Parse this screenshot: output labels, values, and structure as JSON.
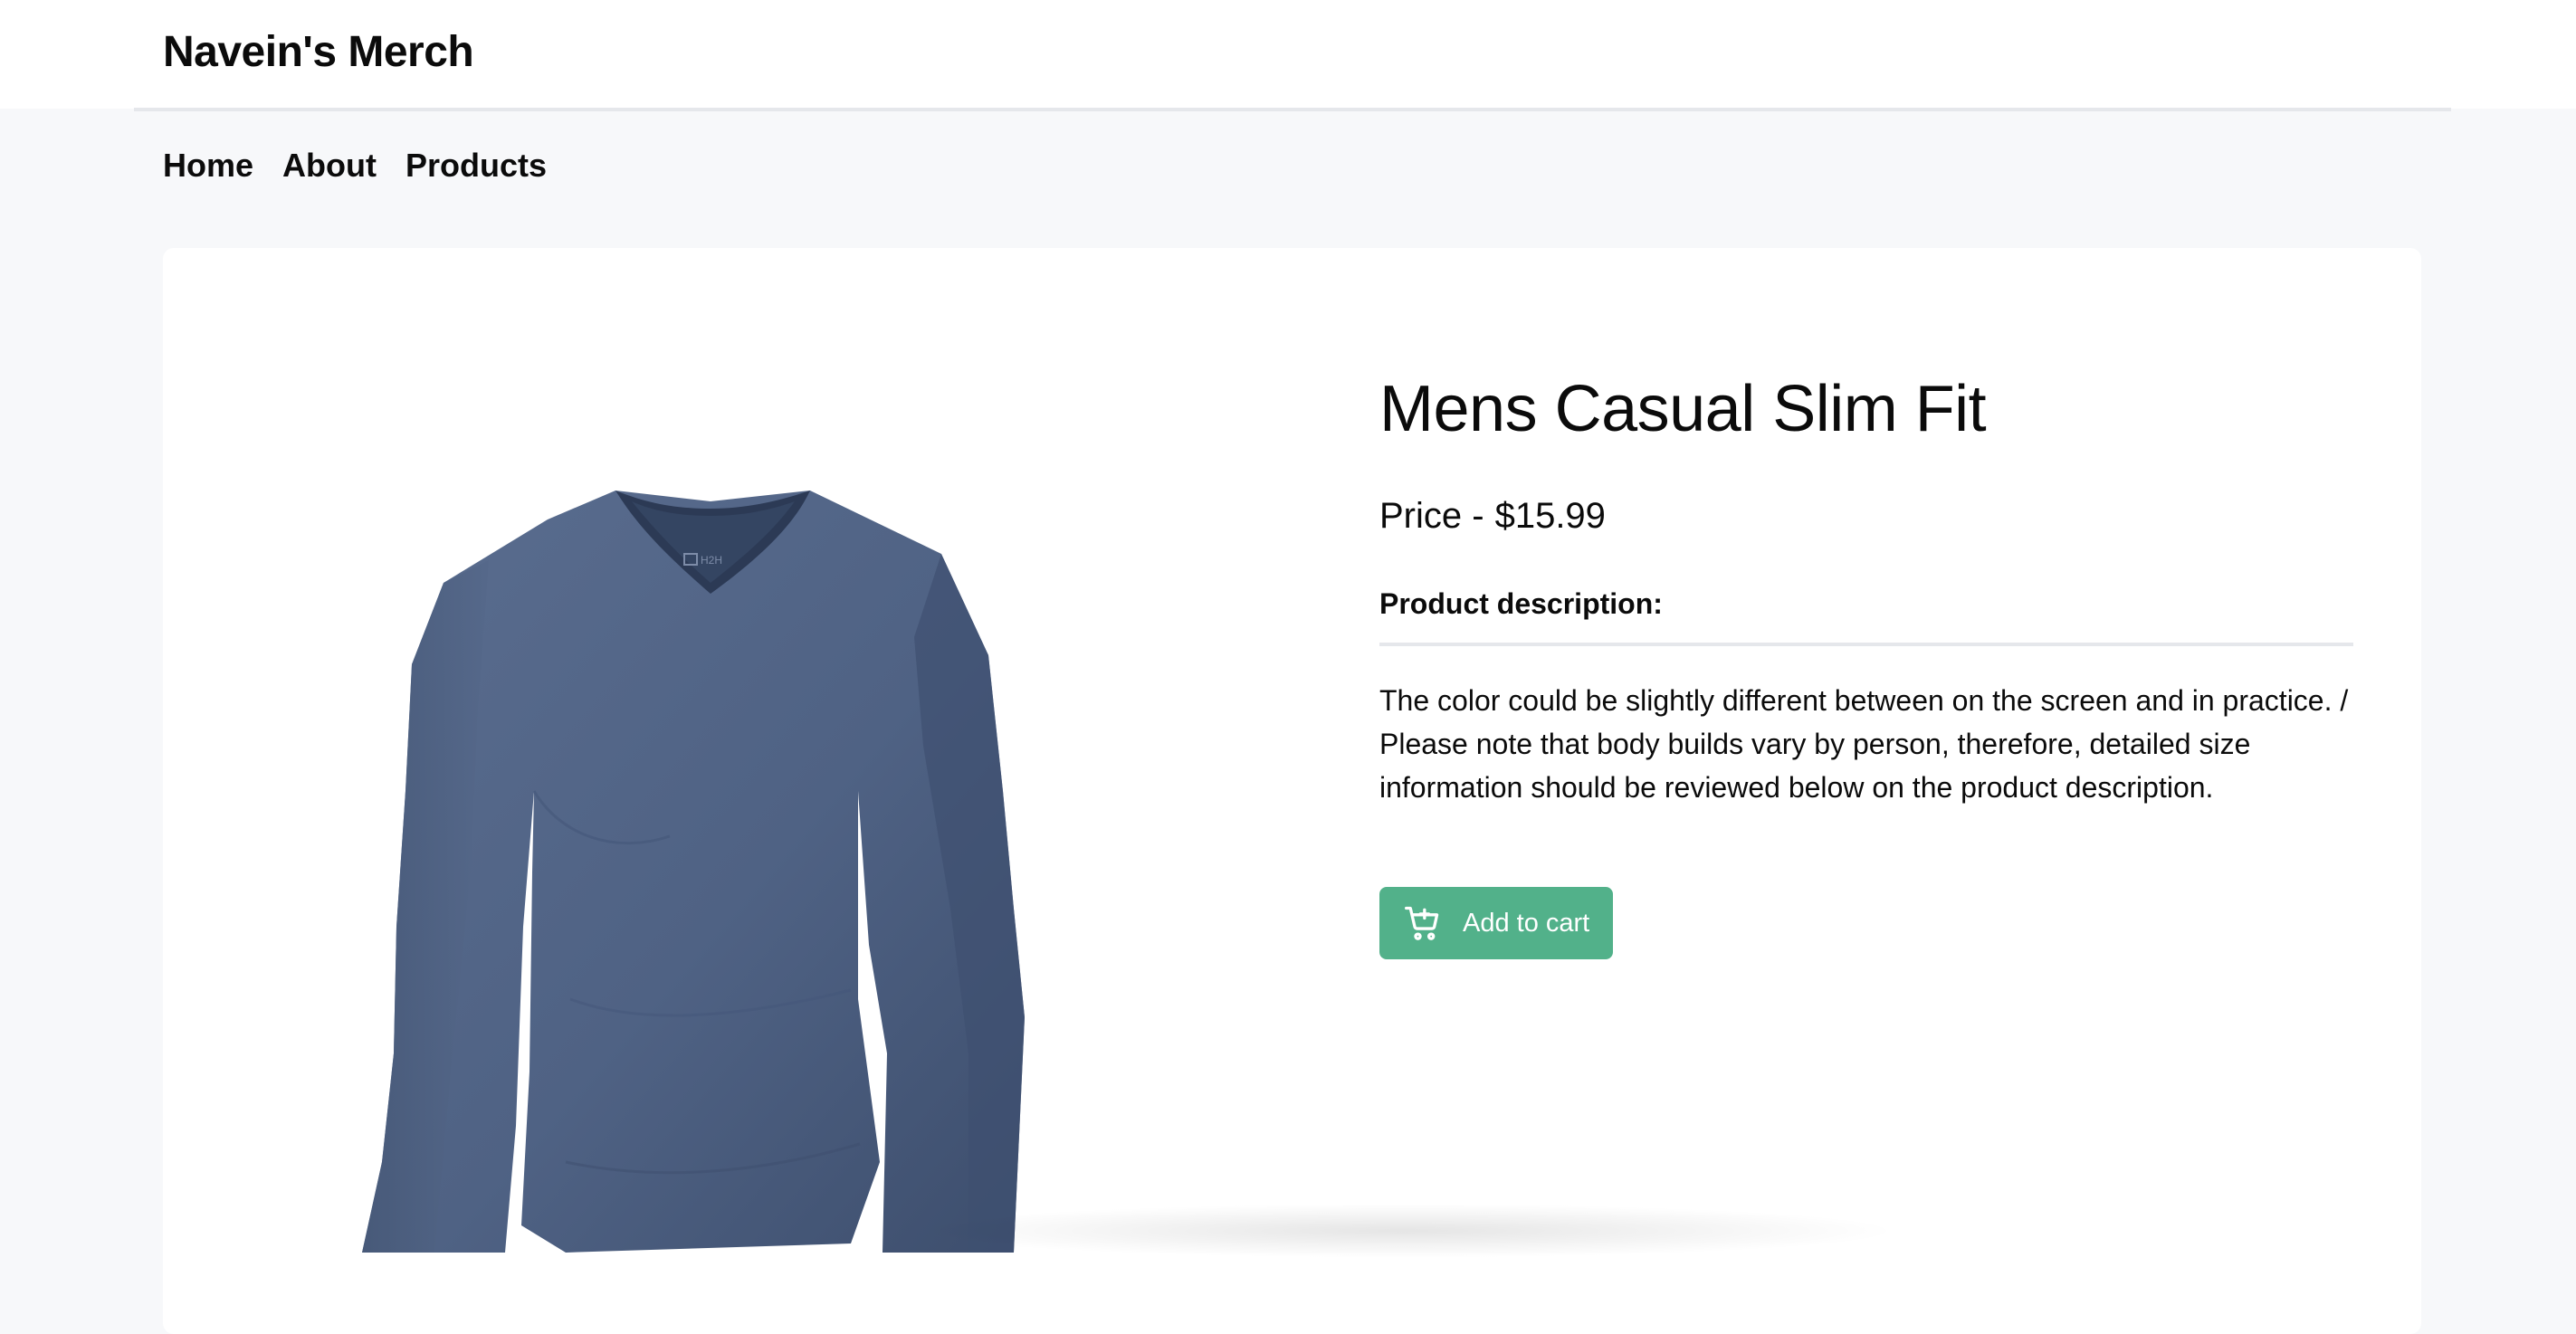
{
  "header": {
    "brand": "Navein's Merch"
  },
  "nav": {
    "items": [
      {
        "label": "Home"
      },
      {
        "label": "About"
      },
      {
        "label": "Products"
      }
    ]
  },
  "product": {
    "title": "Mens Casual Slim Fit",
    "price_label": "Price -",
    "price": "$15.99",
    "description_heading": "Product description:",
    "description": "The color could be slightly different between on the screen and in practice. / Please note that body builds vary by person, therefore, detailed size information should be reviewed below on the product description.",
    "add_to_cart_label": "Add to cart",
    "add_to_cart_icon": "cart-plus-icon",
    "image_subject": "long-sleeve-v-neck-shirt",
    "colors": {
      "shirt": "#4f6284",
      "accent_button": "#52b18a"
    }
  }
}
